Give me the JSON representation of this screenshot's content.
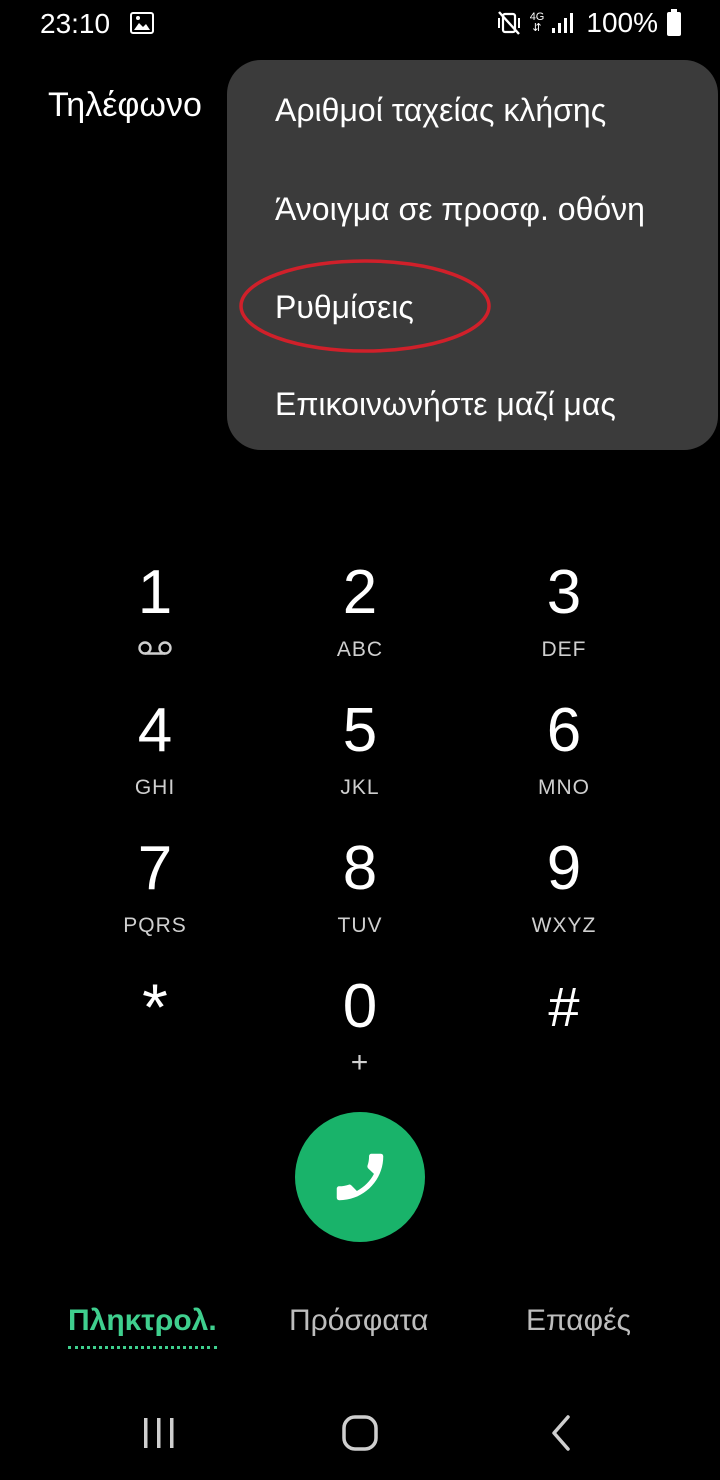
{
  "status_bar": {
    "time": "23:10",
    "network": "4G",
    "battery_percent": "100%",
    "icons": [
      "gallery-notification-icon",
      "mute-vibrate-icon",
      "network-4g-icon",
      "signal-icon",
      "battery-icon"
    ]
  },
  "app": {
    "title": "Τηλέφωνο"
  },
  "menu": {
    "items": [
      "Αριθμοί ταχείας κλήσης",
      "Άνοιγμα σε προσφ. οθόνη",
      "Ρυθμίσεις",
      "Επικοινωνήστε μαζί μας"
    ],
    "highlighted_index": 2,
    "highlight_color": "#d0202a",
    "background": "#3b3b3b"
  },
  "keypad": {
    "keys": [
      {
        "digit": "1",
        "letters": "",
        "icon": "voicemail-icon"
      },
      {
        "digit": "2",
        "letters": "ABC"
      },
      {
        "digit": "3",
        "letters": "DEF"
      },
      {
        "digit": "4",
        "letters": "GHI"
      },
      {
        "digit": "5",
        "letters": "JKL"
      },
      {
        "digit": "6",
        "letters": "MNO"
      },
      {
        "digit": "7",
        "letters": "PQRS"
      },
      {
        "digit": "8",
        "letters": "TUV"
      },
      {
        "digit": "9",
        "letters": "WXYZ"
      },
      {
        "digit": "*",
        "letters": ""
      },
      {
        "digit": "0",
        "letters": "+"
      },
      {
        "digit": "#",
        "letters": ""
      }
    ]
  },
  "call_button": {
    "icon": "phone-icon",
    "color": "#19b36a"
  },
  "tabs": {
    "keypad": "Πληκτρολ.",
    "recent": "Πρόσφατα",
    "contacts": "Επαφές",
    "active_color": "#3fcf8e"
  },
  "nav": {
    "icons": [
      "recent-apps-icon",
      "home-icon",
      "back-icon"
    ]
  }
}
